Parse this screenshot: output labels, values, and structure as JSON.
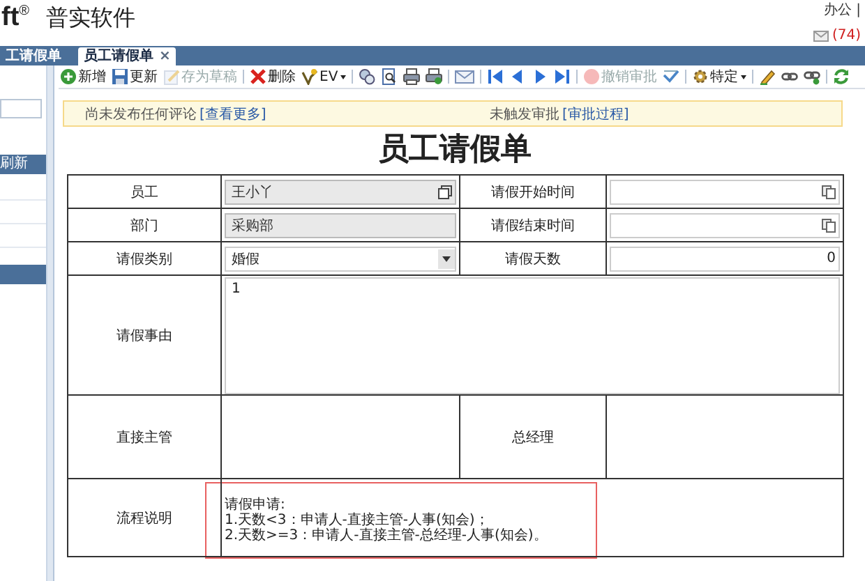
{
  "header": {
    "logo": "ft$^{®}$",
    "product": "普实软件",
    "top_links": "办公 |",
    "mail_count": "(74)"
  },
  "tabs": [
    {
      "label": "工请假单",
      "selected": false
    },
    {
      "label": "员工请假单",
      "selected": true,
      "close": "×"
    }
  ],
  "sidebar": {
    "items": [
      {
        "kind": "field"
      },
      {
        "kind": "bar",
        "label": "刷新"
      },
      {
        "kind": "row"
      },
      {
        "kind": "row"
      },
      {
        "kind": "row"
      },
      {
        "kind": "bar"
      }
    ]
  },
  "toolbar": [
    {
      "kind": "button",
      "label": "新增",
      "disabled": false
    },
    {
      "kind": "button",
      "label": "更新",
      "disabled": false
    },
    {
      "kind": "button",
      "label": "存为草稿",
      "disabled": true
    },
    {
      "kind": "separator"
    },
    {
      "kind": "button",
      "label": "删除",
      "disabled": false
    },
    {
      "kind": "button",
      "label": "EV",
      "disabled": false,
      "dropdown": true
    },
    {
      "kind": "separator"
    },
    {
      "kind": "icon"
    },
    {
      "kind": "icon"
    },
    {
      "kind": "icon"
    },
    {
      "kind": "icon"
    },
    {
      "kind": "separator"
    },
    {
      "kind": "icon"
    },
    {
      "kind": "separator"
    },
    {
      "kind": "icon"
    },
    {
      "kind": "icon"
    },
    {
      "kind": "icon"
    },
    {
      "kind": "icon"
    },
    {
      "kind": "separator"
    },
    {
      "kind": "button",
      "label": "撤销审批",
      "disabled": true
    },
    {
      "kind": "icon"
    },
    {
      "kind": "separator"
    },
    {
      "kind": "button",
      "label": "特定",
      "disabled": false,
      "dropdown": true
    },
    {
      "kind": "separator"
    },
    {
      "kind": "icon"
    },
    {
      "kind": "icon"
    },
    {
      "kind": "icon"
    },
    {
      "kind": "separator"
    },
    {
      "kind": "icon"
    }
  ],
  "notices": [
    {
      "text": "尚未发布任何评论",
      "link": "[查看更多]"
    },
    {
      "text": "未触发审批",
      "link": "[审批过程]"
    }
  ],
  "form": {
    "title": "员工请假单",
    "rows": [
      {
        "cells": [
          {
            "label": "员工",
            "field": {
              "kind": "lookup",
              "value": "王小丫",
              "readonly": true
            }
          },
          {
            "label": "请假开始时间",
            "field": {
              "kind": "date",
              "readonly": false
            }
          }
        ]
      },
      {
        "cells": [
          {
            "label": "部门",
            "field": {
              "kind": "text",
              "value": "采购部",
              "readonly": true
            }
          },
          {
            "label": "请假结束时间",
            "field": {
              "kind": "date",
              "readonly": false
            }
          }
        ]
      },
      {
        "cells": [
          {
            "label": "请假类别",
            "field": {
              "kind": "select",
              "value": "婚假",
              "readonly": false
            }
          },
          {
            "label": "请假天数",
            "field": {
              "kind": "number",
              "value": "0",
              "readonly": false
            }
          }
        ]
      },
      {
        "cells": [
          {
            "label": "请假事由",
            "field": {
              "kind": "textarea",
              "value": "1"
            }
          }
        ]
      },
      {
        "cells": [
          {
            "label": "直接主管",
            "field": {
              "kind": "blank"
            }
          },
          {
            "label": "总经理",
            "field": {
              "kind": "blank"
            }
          }
        ]
      },
      {
        "cells": [
          {
            "label": "流程说明",
            "field": {
              "kind": "note",
              "lines": [
                "请假申请:",
                "1.天数<3：申请人-直接主管-人事(知会)；",
                "2.天数>=3：申请人-直接主管-总经理-人事(知会)。"
              ]
            }
          }
        ]
      }
    ]
  }
}
